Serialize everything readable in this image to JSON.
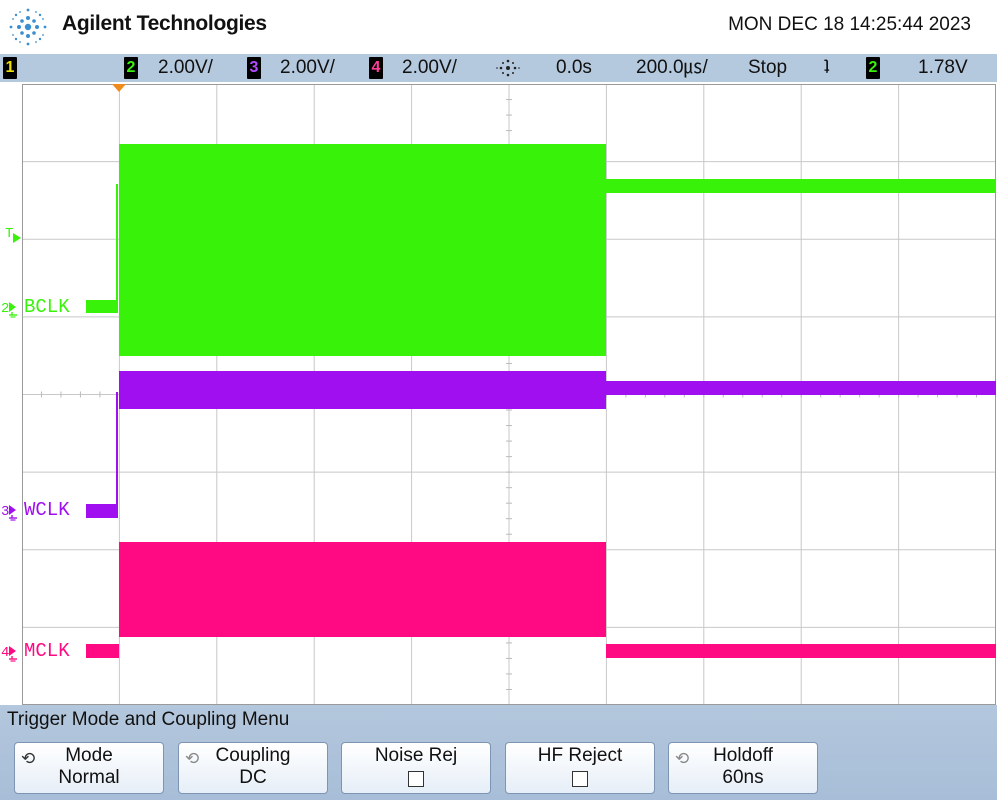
{
  "header": {
    "brand": "Agilent Technologies",
    "timestamp": "MON DEC 18 14:25:44 2023"
  },
  "status": {
    "ch1": "1",
    "ch2": "2",
    "ch2_scale": "2.00V/",
    "ch3": "3",
    "ch3_scale": "2.00V/",
    "ch4": "4",
    "ch4_scale": "2.00V/",
    "delay": "0.0s",
    "timebase": "200.0㎲/",
    "run_state": "Stop",
    "trigger_edge": "ʇ",
    "trig_ch": "2",
    "trig_level": "1.78V"
  },
  "traces": {
    "bclk": {
      "label": "BCLK",
      "number": "2",
      "color": "#38f20a"
    },
    "wclk": {
      "label": "WCLK",
      "number": "3",
      "color": "#a00ff0"
    },
    "mclk": {
      "label": "MCLK",
      "number": "4",
      "color": "#ff0a82"
    },
    "trigger_marker": "T"
  },
  "menu": {
    "title": "Trigger Mode and Coupling Menu",
    "keys": [
      {
        "top": "Mode",
        "bottom": "Normal"
      },
      {
        "top": "Coupling",
        "bottom": "DC"
      },
      {
        "top": "Noise Rej",
        "bottom": ""
      },
      {
        "top": "HF Reject",
        "bottom": ""
      },
      {
        "top": "Holdoff",
        "bottom": "60ns"
      }
    ]
  },
  "colors": {
    "status_bg": "#b4c8de",
    "ch1": "#f0e000",
    "ch2": "#38f20a",
    "ch3": "#a00ff0",
    "ch4": "#ff0a82"
  }
}
